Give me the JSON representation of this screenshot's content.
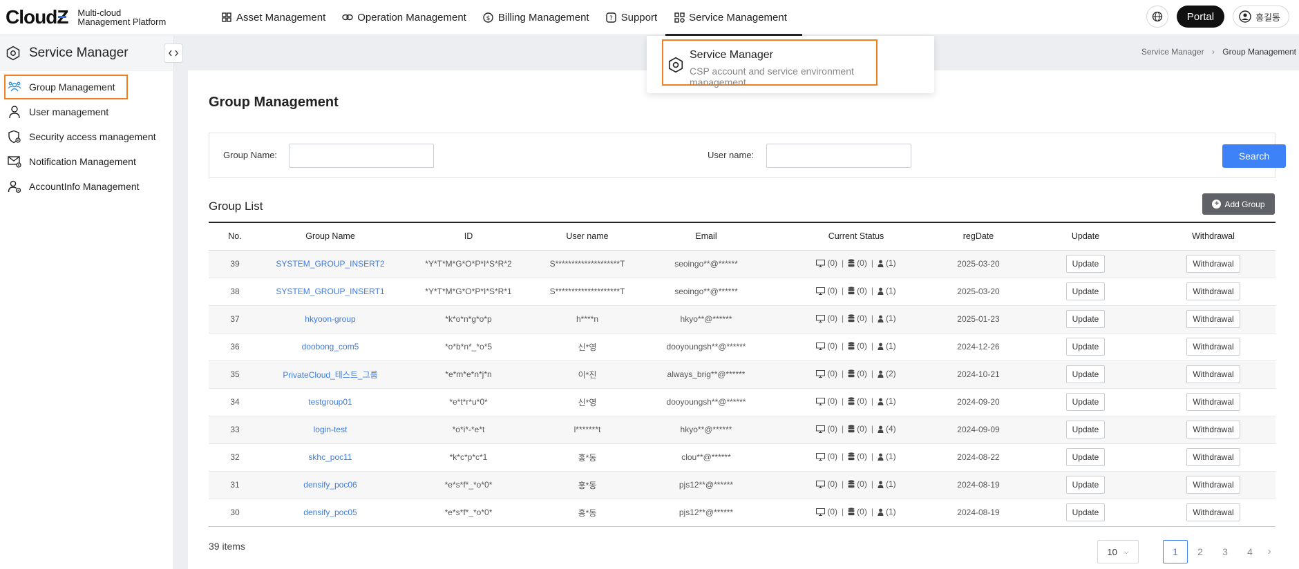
{
  "header": {
    "logo": "Cloud",
    "logo_z": "Z",
    "logo_sub_1": "Multi-cloud",
    "logo_sub_2": "Management Platform",
    "nav": [
      {
        "label": "Asset Management",
        "icon": "grid-icon"
      },
      {
        "label": "Operation Management",
        "icon": "link-icon"
      },
      {
        "label": "Billing Management",
        "icon": "dollar-icon"
      },
      {
        "label": "Support",
        "icon": "question-icon"
      },
      {
        "label": "Service Management",
        "icon": "grid-gear-icon"
      }
    ],
    "portal": "Portal",
    "user": "홍길동"
  },
  "dropdown": {
    "title": "Service Manager",
    "desc": "CSP account and service environment management"
  },
  "sidebar": {
    "title": "Service Manager",
    "items": [
      {
        "label": "Group Management",
        "icon": "group-icon"
      },
      {
        "label": "User management",
        "icon": "user-icon"
      },
      {
        "label": "Security access management",
        "icon": "shield-gear-icon"
      },
      {
        "label": "Notification Management",
        "icon": "mail-gear-icon"
      },
      {
        "label": "AccountInfo Management",
        "icon": "user-gear-icon"
      }
    ]
  },
  "breadcrumb": {
    "parent": "Service Manager",
    "sep": "›",
    "current": "Group Management"
  },
  "page": {
    "title": "Group Management",
    "search": {
      "group_label": "Group Name:",
      "user_label": "User name:",
      "button": "Search"
    },
    "list_title": "Group List",
    "add_button": "Add Group",
    "columns": [
      "No.",
      "Group Name",
      "ID",
      "User name",
      "Email",
      "Current Status",
      "regDate",
      "Update",
      "Withdrawal"
    ],
    "rows": [
      {
        "no": "39",
        "name": "SYSTEM_GROUP_INSERT2",
        "id": "*Y*T*M*G*O*P*I*S*R*2",
        "user": "S********************T",
        "email": "seoingo**@******",
        "s1": "(0)",
        "s2": "(0)",
        "s3": "(1)",
        "date": "2025-03-20"
      },
      {
        "no": "38",
        "name": "SYSTEM_GROUP_INSERT1",
        "id": "*Y*T*M*G*O*P*I*S*R*1",
        "user": "S********************T",
        "email": "seoingo**@******",
        "s1": "(0)",
        "s2": "(0)",
        "s3": "(1)",
        "date": "2025-03-20"
      },
      {
        "no": "37",
        "name": "hkyoon-group",
        "id": "*k*o*n*g*o*p",
        "user": "h****n",
        "email": "hkyo**@******",
        "s1": "(0)",
        "s2": "(0)",
        "s3": "(1)",
        "date": "2025-01-23"
      },
      {
        "no": "36",
        "name": "doobong_com5",
        "id": "*o*b*n*_*o*5",
        "user": "신*영",
        "email": "dooyoungsh**@******",
        "s1": "(0)",
        "s2": "(0)",
        "s3": "(1)",
        "date": "2024-12-26"
      },
      {
        "no": "35",
        "name": "PrivateCloud_테스트_그룹",
        "id": "*e*m*e*n*j*n",
        "user": "이*진",
        "email": "always_brig**@******",
        "s1": "(0)",
        "s2": "(0)",
        "s3": "(2)",
        "date": "2024-10-21"
      },
      {
        "no": "34",
        "name": "testgroup01",
        "id": "*e*t*r*u*0*",
        "user": "신*영",
        "email": "dooyoungsh**@******",
        "s1": "(0)",
        "s2": "(0)",
        "s3": "(1)",
        "date": "2024-09-20"
      },
      {
        "no": "33",
        "name": "login-test",
        "id": "*o*i*-*e*t",
        "user": "l*******t",
        "email": "hkyo**@******",
        "s1": "(0)",
        "s2": "(0)",
        "s3": "(4)",
        "date": "2024-09-09"
      },
      {
        "no": "32",
        "name": "skhc_poc11",
        "id": "*k*c*p*c*1",
        "user": "홍*동",
        "email": "clou**@******",
        "s1": "(0)",
        "s2": "(0)",
        "s3": "(1)",
        "date": "2024-08-22"
      },
      {
        "no": "31",
        "name": "densify_poc06",
        "id": "*e*s*f*_*o*0*",
        "user": "홍*동",
        "email": "pjs12**@******",
        "s1": "(0)",
        "s2": "(0)",
        "s3": "(1)",
        "date": "2024-08-19"
      },
      {
        "no": "30",
        "name": "densify_poc05",
        "id": "*e*s*f*_*o*0*",
        "user": "홍*동",
        "email": "pjs12**@******",
        "s1": "(0)",
        "s2": "(0)",
        "s3": "(1)",
        "date": "2024-08-19"
      }
    ],
    "update_label": "Update",
    "withdrawal_label": "Withdrawal",
    "items_count": "39 items",
    "page_size": "10",
    "pages": [
      "1",
      "2",
      "3",
      "4"
    ],
    "current_page": "1"
  },
  "colors": {
    "accent": "#3d82f7",
    "highlight": "#f07f1d",
    "link": "#3d7be0",
    "dark": "#111111"
  }
}
